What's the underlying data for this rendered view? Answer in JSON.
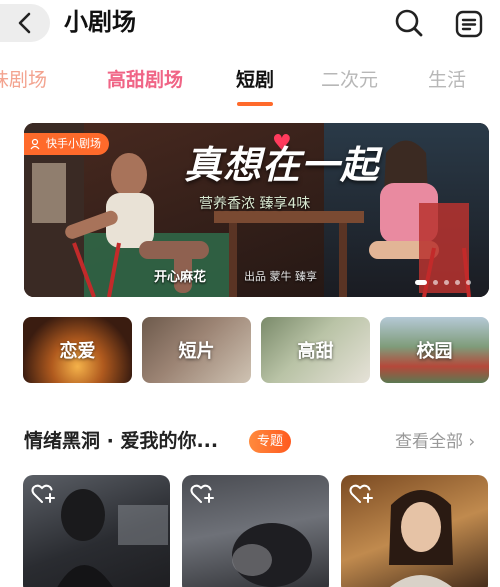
{
  "header": {
    "title": "小剧场",
    "back_icon": "chevron-left-icon",
    "search_icon": "search-icon",
    "menu_icon": "list-menu-icon"
  },
  "tabs": [
    {
      "label": "味剧场",
      "state": "faded"
    },
    {
      "label": "高甜剧场",
      "state": "brand"
    },
    {
      "label": "短剧",
      "state": "active"
    },
    {
      "label": "二次元",
      "state": "normal"
    },
    {
      "label": "生活",
      "state": "normal"
    }
  ],
  "banner": {
    "badge": "快手小剧场",
    "headline": "真想在一起",
    "tagline": "营养香浓 臻享4味",
    "brand": "开心麻花",
    "sponsors": "出品  蒙牛  臻享",
    "slides": 5,
    "active_slide": 0
  },
  "categories": [
    {
      "label": "恋爱"
    },
    {
      "label": "短片"
    },
    {
      "label": "高甜"
    },
    {
      "label": "校园"
    }
  ],
  "section": {
    "title": "情绪黑洞 · 爱我的你...",
    "tag": "专题",
    "see_all": "查看全部 ›"
  },
  "cards": [
    {
      "fav_icon": "heart-plus-icon"
    },
    {
      "fav_icon": "heart-plus-icon"
    },
    {
      "fav_icon": "heart-plus-icon"
    }
  ],
  "colors": {
    "accent": "#ff6a2b",
    "brand_pink": "#f06586",
    "muted": "#b7b7b7"
  }
}
